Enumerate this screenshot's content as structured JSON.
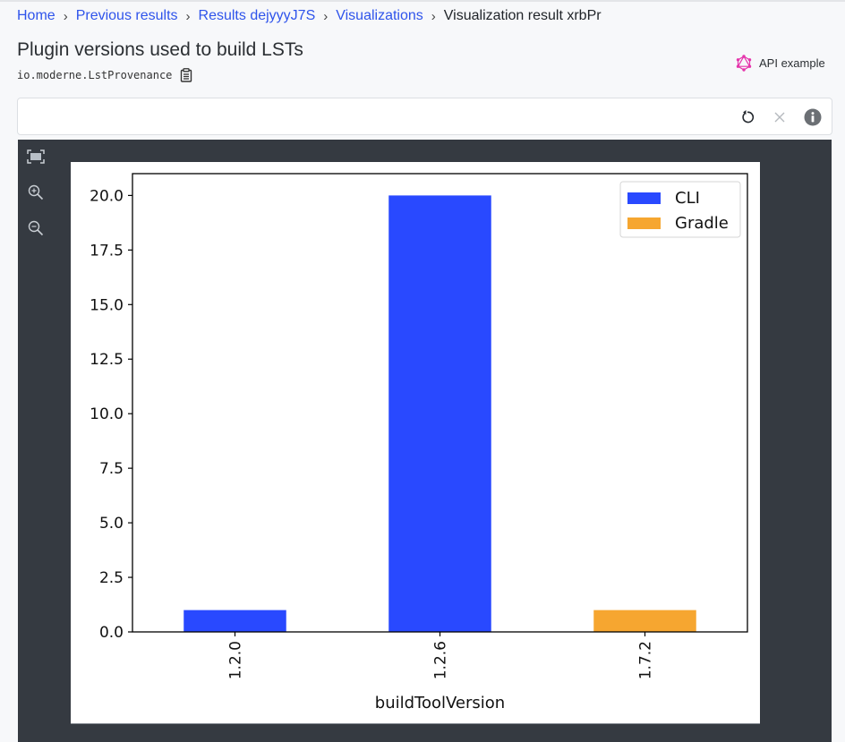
{
  "breadcrumb": [
    {
      "label": "Home",
      "link": true
    },
    {
      "label": "Previous results",
      "link": true
    },
    {
      "label": "Results dejyyyJ7S",
      "link": true
    },
    {
      "label": "Visualizations",
      "link": true
    },
    {
      "label": "Visualization result xrbPr",
      "link": false
    }
  ],
  "breadcrumb_separator": "›",
  "header": {
    "title": "Plugin versions used to build LSTs",
    "subtitle": "io.moderne.LstProvenance",
    "api_example_label": "API example"
  },
  "filter": {
    "value": "",
    "placeholder": ""
  },
  "toolbar_icons": [
    "fit-to-screen-icon",
    "zoom-in-icon",
    "zoom-out-icon"
  ],
  "colors": {
    "link": "#2f54eb",
    "graphql_icon": "#e535ab",
    "cli": "#2949ff",
    "gradle": "#f6a630",
    "panel": "#353a41"
  },
  "chart_data": {
    "type": "bar",
    "stacked": true,
    "title": "",
    "xlabel": "buildToolVersion",
    "ylabel": "",
    "categories": [
      "1.2.0",
      "1.2.6",
      "1.7.2"
    ],
    "series": [
      {
        "name": "CLI",
        "color": "#2949ff",
        "values": [
          1,
          20,
          0
        ]
      },
      {
        "name": "Gradle",
        "color": "#f6a630",
        "values": [
          0,
          0,
          1
        ]
      }
    ],
    "ylim": [
      0,
      21
    ],
    "yticks": [
      0.0,
      2.5,
      5.0,
      7.5,
      10.0,
      12.5,
      15.0,
      17.5,
      20.0
    ],
    "ytick_labels": [
      "0.0",
      "2.5",
      "5.0",
      "7.5",
      "10.0",
      "12.5",
      "15.0",
      "17.5",
      "20.0"
    ],
    "xtick_rotation": "vertical",
    "grid": false,
    "legend": {
      "position": "top-right",
      "entries": [
        "CLI",
        "Gradle"
      ]
    }
  }
}
